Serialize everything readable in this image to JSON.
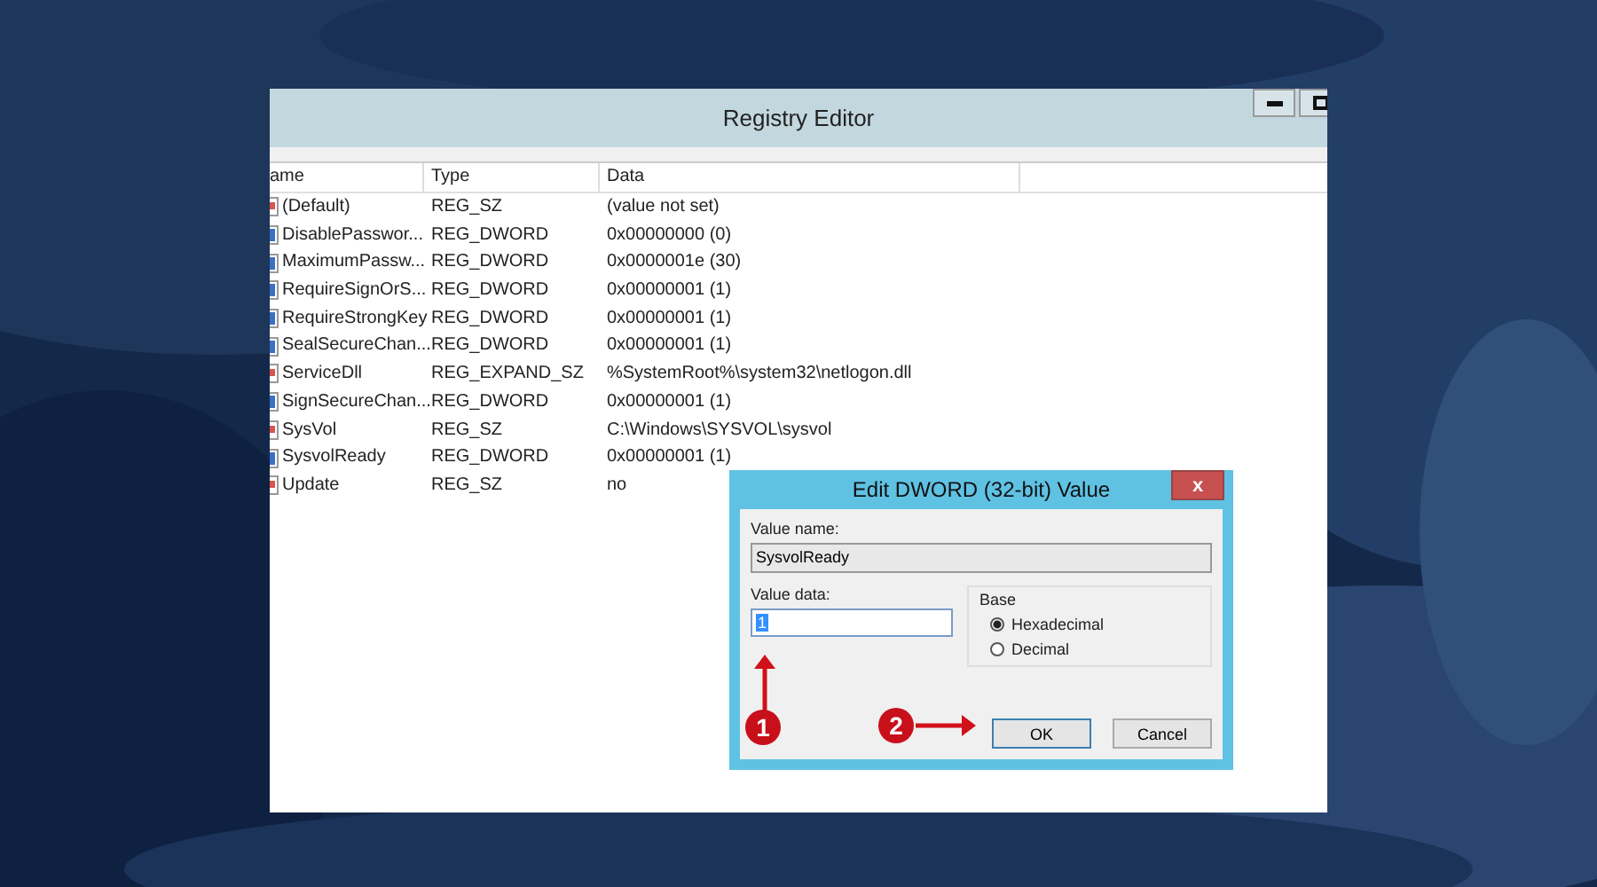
{
  "window": {
    "title": "Registry Editor"
  },
  "table": {
    "columns": [
      "ame",
      "Type",
      "Data"
    ],
    "rows": [
      {
        "kind": "string",
        "name": "(Default)",
        "type": "REG_SZ",
        "data": "(value not set)"
      },
      {
        "kind": "binary",
        "name": "DisablePasswor...",
        "type": "REG_DWORD",
        "data": "0x00000000 (0)"
      },
      {
        "kind": "binary",
        "name": "MaximumPassw...",
        "type": "REG_DWORD",
        "data": "0x0000001e (30)"
      },
      {
        "kind": "binary",
        "name": "RequireSignOrS...",
        "type": "REG_DWORD",
        "data": "0x00000001 (1)"
      },
      {
        "kind": "binary",
        "name": "RequireStrongKey",
        "type": "REG_DWORD",
        "data": "0x00000001 (1)"
      },
      {
        "kind": "binary",
        "name": "SealSecureChan...",
        "type": "REG_DWORD",
        "data": "0x00000001 (1)"
      },
      {
        "kind": "string",
        "name": "ServiceDll",
        "type": "REG_EXPAND_SZ",
        "data": "%SystemRoot%\\system32\\netlogon.dll"
      },
      {
        "kind": "binary",
        "name": "SignSecureChan...",
        "type": "REG_DWORD",
        "data": "0x00000001 (1)"
      },
      {
        "kind": "string",
        "name": "SysVol",
        "type": "REG_SZ",
        "data": "C:\\Windows\\SYSVOL\\sysvol"
      },
      {
        "kind": "binary",
        "name": "SysvolReady",
        "type": "REG_DWORD",
        "data": "0x00000001 (1)"
      },
      {
        "kind": "string",
        "name": "Update",
        "type": "REG_SZ",
        "data": "no"
      }
    ]
  },
  "dialog": {
    "title": "Edit DWORD (32-bit) Value",
    "close": "x",
    "value_name_label": "Value name:",
    "value_name": "SysvolReady",
    "value_data_label": "Value data:",
    "value_data": "1",
    "base_label": "Base",
    "base_options": [
      {
        "label": "Hexadecimal",
        "selected": true
      },
      {
        "label": "Decimal",
        "selected": false
      }
    ],
    "buttons": [
      "OK",
      "Cancel"
    ]
  },
  "annotations": [
    "1",
    "2"
  ]
}
